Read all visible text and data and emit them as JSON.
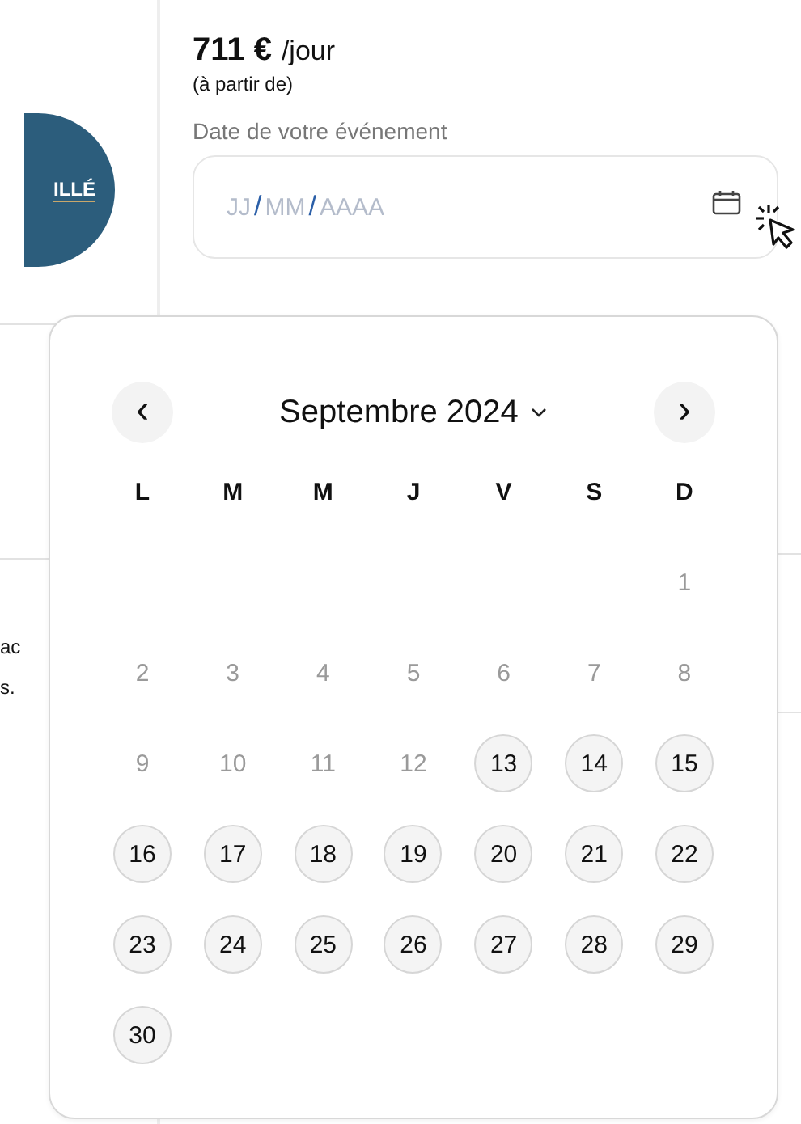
{
  "logo": {
    "text": "ILLÉ"
  },
  "side_fragments": [
    "ac",
    "s."
  ],
  "price": {
    "amount": "711 €",
    "unit": "/jour",
    "note": "(à partir de)"
  },
  "date_field": {
    "label": "Date de votre événement",
    "parts": [
      {
        "kind": "segment",
        "text": "JJ"
      },
      {
        "kind": "separator",
        "text": "/"
      },
      {
        "kind": "segment",
        "text": "MM"
      },
      {
        "kind": "separator",
        "text": "/"
      },
      {
        "kind": "segment",
        "text": "AAAA"
      }
    ]
  },
  "calendar": {
    "prev": "‹",
    "next": "›",
    "month": "Septembre 2024",
    "weekdays": [
      "L",
      "M",
      "M",
      "J",
      "V",
      "S",
      "D"
    ],
    "weeks": [
      {
        "kind": "partial",
        "days": [
          {
            "day": "1",
            "available": false
          }
        ]
      },
      {
        "kind": "full",
        "days": [
          {
            "day": "2",
            "available": false
          },
          {
            "day": "3",
            "available": false
          },
          {
            "day": "4",
            "available": false
          },
          {
            "day": "5",
            "available": false
          },
          {
            "day": "6",
            "available": false
          },
          {
            "day": "7",
            "available": false
          },
          {
            "day": "8",
            "available": false
          }
        ]
      },
      {
        "kind": "full",
        "days": [
          {
            "day": "9",
            "available": false
          },
          {
            "day": "10",
            "available": false
          },
          {
            "day": "11",
            "available": false
          },
          {
            "day": "12",
            "available": false
          },
          {
            "day": "13",
            "available": true
          },
          {
            "day": "14",
            "available": true
          },
          {
            "day": "15",
            "available": true
          }
        ]
      },
      {
        "kind": "full",
        "days": [
          {
            "day": "16",
            "available": true
          },
          {
            "day": "17",
            "available": true
          },
          {
            "day": "18",
            "available": true
          },
          {
            "day": "19",
            "available": true
          },
          {
            "day": "20",
            "available": true
          },
          {
            "day": "21",
            "available": true
          },
          {
            "day": "22",
            "available": true
          }
        ]
      },
      {
        "kind": "full",
        "days": [
          {
            "day": "23",
            "available": true
          },
          {
            "day": "24",
            "available": true
          },
          {
            "day": "25",
            "available": true
          },
          {
            "day": "26",
            "available": true
          },
          {
            "day": "27",
            "available": true
          },
          {
            "day": "28",
            "available": true
          },
          {
            "day": "29",
            "available": true
          }
        ]
      },
      {
        "kind": "last",
        "days": [
          {
            "day": "30",
            "available": true
          }
        ]
      }
    ]
  }
}
